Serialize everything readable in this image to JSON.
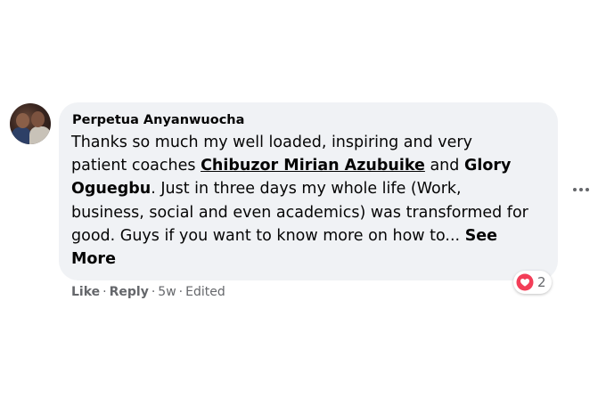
{
  "comment": {
    "author": "Perpetua Anyanwuocha",
    "line1": "Thanks so much my well loaded, inspiring and very",
    "line2_pre": "patient coaches ",
    "mention1": "Chibuzor Mirian Azubuike",
    "line2_mid": " and ",
    "mention2_a": "Glory",
    "mention2_b": "Oguegbu",
    "line3_post": ". Just in three days my whole life (Work,",
    "line4": "business, social and even academics) was transformed for",
    "line5": "good. Guys if you want to know more on how to... ",
    "see_more_a": "See",
    "see_more_b": "More"
  },
  "reactions": {
    "icon": "heart-icon",
    "count": "2",
    "color": "#f33e58"
  },
  "actions": {
    "like": "Like",
    "reply": "Reply",
    "time": "5w",
    "edited": "Edited",
    "separator": "·"
  }
}
